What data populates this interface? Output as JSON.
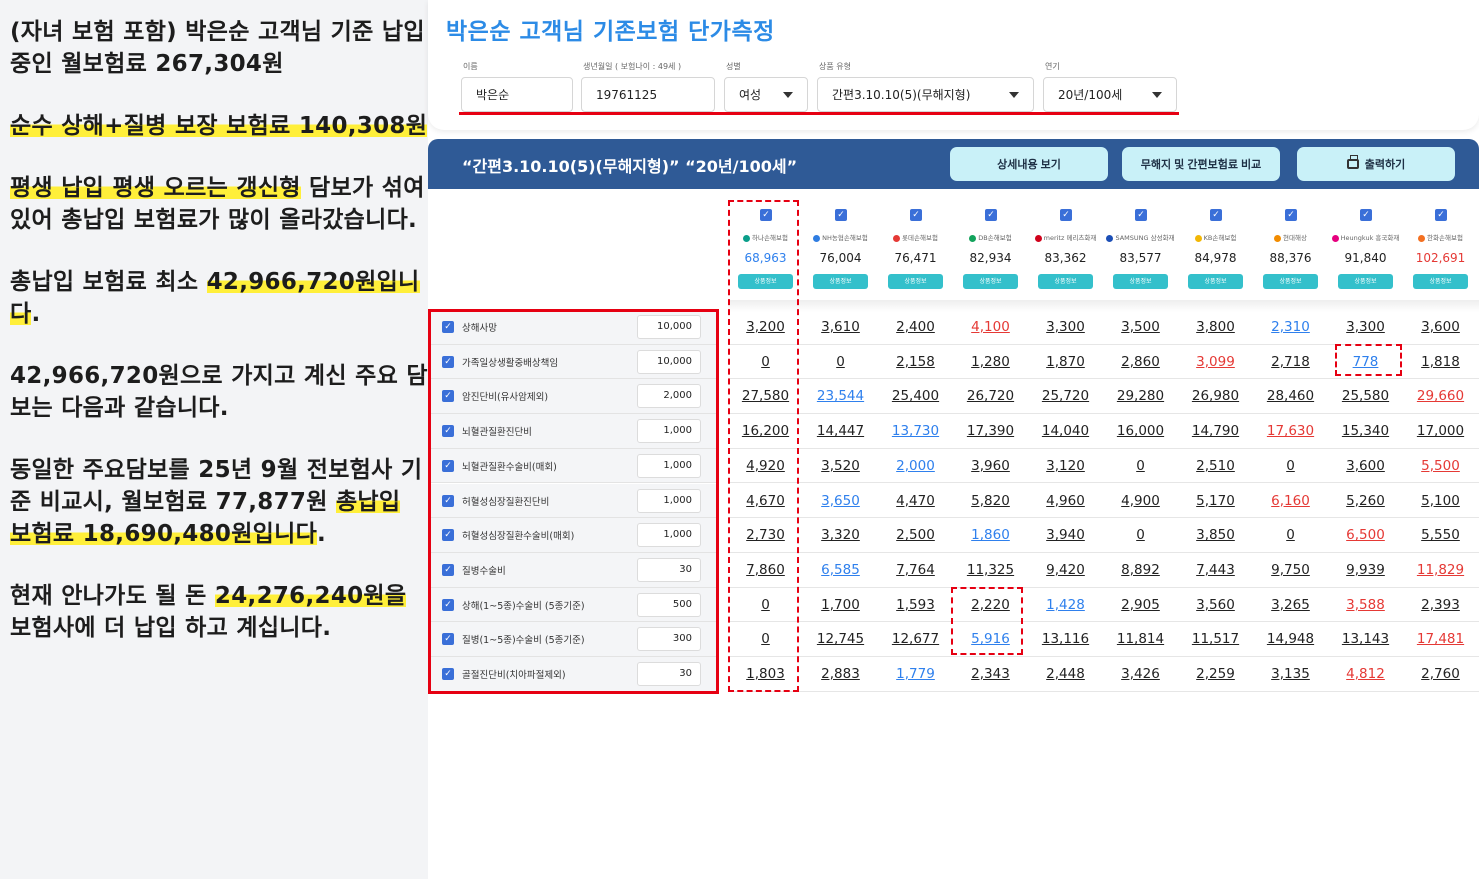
{
  "notes": [
    {
      "parts": [
        {
          "text": "(자녀 보험 포함) 박은순 고객님 기준 납입중인 월보험료 267,304원",
          "hl": false
        }
      ]
    },
    {
      "parts": [
        {
          "text": "순수 상해+질병 보장 보험료 140,308원",
          "hl": true
        }
      ]
    },
    {
      "parts": [
        {
          "text": "평생 납입 평생 오르는 갱신형",
          "hl": true
        },
        {
          "text": " 담보가 섞여 있어 총납입 보험료가 많이 올라갔습니다.",
          "hl": false
        }
      ]
    },
    {
      "parts": [
        {
          "text": "총납입 보험료 최소 ",
          "hl": false
        },
        {
          "text": "42,966,720원입니다",
          "hl": true
        },
        {
          "text": ".",
          "hl": false
        }
      ]
    },
    {
      "parts": [
        {
          "text": "42,966,720원으로 가지고 계신 주요 담보는 다음과 같습니다.",
          "hl": false
        }
      ]
    },
    {
      "parts": [
        {
          "text": "동일한 주요담보를 25년 9월 전보험사 기준 비교시, 월보험료 77,877원 ",
          "hl": false
        },
        {
          "text": "총납입 보험료 18,690,480원입니다",
          "hl": true
        },
        {
          "text": ".",
          "hl": false
        }
      ]
    },
    {
      "parts": [
        {
          "text": "현재 안나가도 될 돈 ",
          "hl": false
        },
        {
          "text": "24,276,240원을",
          "hl": true
        },
        {
          "text": " 보험사에 더 납입 하고 계십니다.",
          "hl": false
        }
      ]
    }
  ],
  "page_title": "박은순 고객님 기존보험 단가측정",
  "form": {
    "name_label": "이름",
    "name_value": "박은순",
    "birth_label": "생년월일 ( 보험나이 : 49세 )",
    "birth_value": "19761125",
    "gender_label": "성별",
    "gender_value": "여성",
    "product_label": "상품 유형",
    "product_value": "간편3.10.10(5)(무해지형)",
    "term_label": "연기",
    "term_value": "20년/100세"
  },
  "banner": {
    "title": "“간편3.10.10(5)(무해지형)” “20년/100세”",
    "detail_btn": "상세내용 보기",
    "compare_btn": "무해지 및 간편보험료 비교",
    "print_btn": "출력하기"
  },
  "companies": [
    {
      "logo": "하나손해보험",
      "dot": "#0a9e8a",
      "price": "68,963",
      "price_color": "#2f80ed",
      "info": "상품정보"
    },
    {
      "logo": "NH농협손해보험",
      "dot": "#2f7de1",
      "price": "76,004",
      "price_color": "#222222",
      "info": "상품정보"
    },
    {
      "logo": "롯데손해보험",
      "dot": "#e53935",
      "price": "76,471",
      "price_color": "#222222",
      "info": "상품정보"
    },
    {
      "logo": "DB손해보험",
      "dot": "#13a35c",
      "price": "82,934",
      "price_color": "#222222",
      "info": "상품정보"
    },
    {
      "logo": "meritz 메리츠화재",
      "dot": "#d0021b",
      "price": "83,362",
      "price_color": "#222222",
      "info": "상품정보"
    },
    {
      "logo": "SAMSUNG 삼성화재",
      "dot": "#1c4fb6",
      "price": "83,577",
      "price_color": "#222222",
      "info": "상품정보"
    },
    {
      "logo": "KB손해보험",
      "dot": "#f2b705",
      "price": "84,978",
      "price_color": "#222222",
      "info": "상품정보"
    },
    {
      "logo": "현대해상",
      "dot": "#f28c00",
      "price": "88,376",
      "price_color": "#222222",
      "info": "상품정보"
    },
    {
      "logo": "Heungkuk 흥국화재",
      "dot": "#e6007e",
      "price": "91,840",
      "price_color": "#222222",
      "info": "상품정보"
    },
    {
      "logo": "한화손해보험",
      "dot": "#f37021",
      "price": "102,691",
      "price_color": "#e53935",
      "info": "상품정보"
    }
  ],
  "coverages": [
    {
      "label": "상해사망",
      "amount": "10,000",
      "values": [
        "3,200",
        "3,610",
        "2,400",
        "4,100",
        "3,300",
        "3,500",
        "3,800",
        "2,310",
        "3,300",
        "3,600"
      ],
      "colors": [
        "k",
        "k",
        "k",
        "r",
        "k",
        "k",
        "k",
        "b",
        "k",
        "k"
      ]
    },
    {
      "label": "가족일상생활중배상책임",
      "amount": "10,000",
      "values": [
        "0",
        "0",
        "2,158",
        "1,280",
        "1,870",
        "2,860",
        "3,099",
        "2,718",
        "778",
        "1,818"
      ],
      "colors": [
        "k",
        "k",
        "k",
        "k",
        "k",
        "k",
        "r",
        "k",
        "b",
        "k"
      ]
    },
    {
      "label": "암진단비(유사암제외)",
      "amount": "2,000",
      "values": [
        "27,580",
        "23,544",
        "25,400",
        "26,720",
        "25,720",
        "29,280",
        "26,980",
        "28,460",
        "25,580",
        "29,660"
      ],
      "colors": [
        "k",
        "b",
        "k",
        "k",
        "k",
        "k",
        "k",
        "k",
        "k",
        "r"
      ]
    },
    {
      "label": "뇌혈관질환진단비",
      "amount": "1,000",
      "values": [
        "16,200",
        "14,447",
        "13,730",
        "17,390",
        "14,040",
        "16,000",
        "14,790",
        "17,630",
        "15,340",
        "17,000"
      ],
      "colors": [
        "k",
        "k",
        "b",
        "k",
        "k",
        "k",
        "k",
        "r",
        "k",
        "k"
      ]
    },
    {
      "label": "뇌혈관질환수술비(매회)",
      "amount": "1,000",
      "values": [
        "4,920",
        "3,520",
        "2,000",
        "3,960",
        "3,120",
        "0",
        "2,510",
        "0",
        "3,600",
        "5,500"
      ],
      "colors": [
        "k",
        "k",
        "b",
        "k",
        "k",
        "k",
        "k",
        "k",
        "k",
        "r"
      ]
    },
    {
      "label": "허혈성심장질환진단비",
      "amount": "1,000",
      "values": [
        "4,670",
        "3,650",
        "4,470",
        "5,820",
        "4,960",
        "4,900",
        "5,170",
        "6,160",
        "5,260",
        "5,100"
      ],
      "colors": [
        "k",
        "b",
        "k",
        "k",
        "k",
        "k",
        "k",
        "r",
        "k",
        "k"
      ]
    },
    {
      "label": "허혈성심장질환수술비(매회)",
      "amount": "1,000",
      "values": [
        "2,730",
        "3,320",
        "2,500",
        "1,860",
        "3,940",
        "0",
        "3,850",
        "0",
        "6,500",
        "5,550"
      ],
      "colors": [
        "k",
        "k",
        "k",
        "b",
        "k",
        "k",
        "k",
        "k",
        "r",
        "k"
      ]
    },
    {
      "label": "질병수술비",
      "amount": "30",
      "values": [
        "7,860",
        "6,585",
        "7,764",
        "11,325",
        "9,420",
        "8,892",
        "7,443",
        "9,750",
        "9,939",
        "11,829"
      ],
      "colors": [
        "k",
        "b",
        "k",
        "k",
        "k",
        "k",
        "k",
        "k",
        "k",
        "r"
      ]
    },
    {
      "label": "상해(1~5종)수술비 (5종기준)",
      "amount": "500",
      "values": [
        "0",
        "1,700",
        "1,593",
        "2,220",
        "1,428",
        "2,905",
        "3,560",
        "3,265",
        "3,588",
        "2,393"
      ],
      "colors": [
        "k",
        "k",
        "k",
        "k",
        "b",
        "k",
        "k",
        "k",
        "r",
        "k"
      ]
    },
    {
      "label": "질병(1~5종)수술비 (5종기준)",
      "amount": "300",
      "values": [
        "0",
        "12,745",
        "12,677",
        "5,916",
        "13,116",
        "11,814",
        "11,517",
        "14,948",
        "13,143",
        "17,481"
      ],
      "colors": [
        "k",
        "k",
        "k",
        "b",
        "k",
        "k",
        "k",
        "k",
        "k",
        "r"
      ]
    },
    {
      "label": "골절진단비(치아파절제외)",
      "amount": "30",
      "values": [
        "1,803",
        "2,883",
        "1,779",
        "2,343",
        "2,448",
        "3,426",
        "2,259",
        "3,135",
        "4,812",
        "2,760"
      ],
      "colors": [
        "k",
        "k",
        "b",
        "k",
        "k",
        "k",
        "k",
        "k",
        "r",
        "k"
      ]
    }
  ],
  "colors": {
    "accent_blue": "#2c8be6",
    "banner": "#2f5a96",
    "button": "#c9f1f8",
    "info_badge": "#34c0cb",
    "highlight": "#ffef3a",
    "annotation_red": "#e60012",
    "value_blue": "#2f80ed",
    "value_red": "#e53935"
  }
}
